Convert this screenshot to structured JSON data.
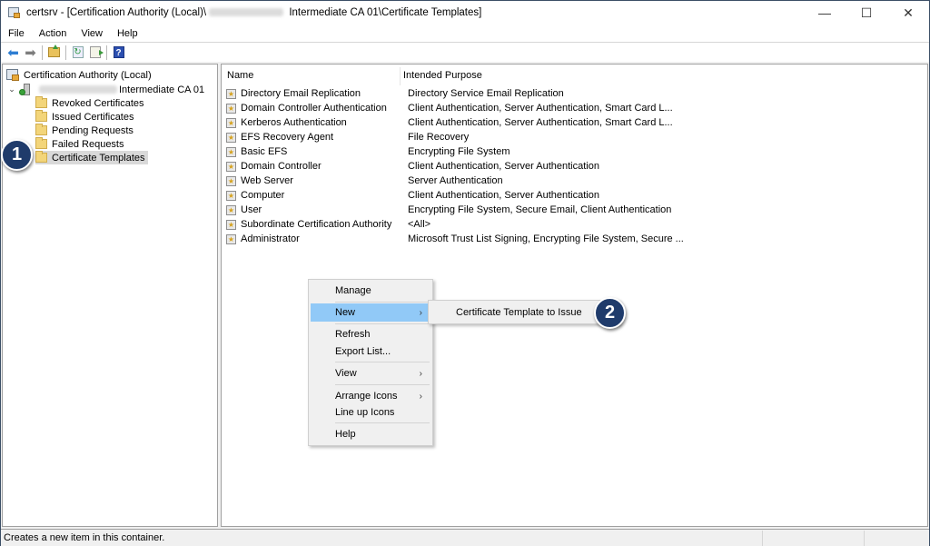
{
  "window": {
    "title_prefix": "certsrv - [Certification Authority (Local)\\",
    "title_suffix": " Intermediate CA 01\\Certificate Templates]",
    "controls": {
      "minimize": "—",
      "maximize": "☐",
      "close": "✕"
    }
  },
  "menubar": {
    "items": [
      "File",
      "Action",
      "View",
      "Help"
    ]
  },
  "toolbar": {
    "icons": [
      "back-arrow-icon",
      "forward-arrow-icon",
      "up-folder-icon",
      "refresh-icon",
      "export-list-icon",
      "help-icon"
    ],
    "help_glyph": "?",
    "back_glyph": "⬅",
    "forward_glyph": "➡",
    "refresh_glyph": "↻"
  },
  "tree": {
    "root": "Certification Authority (Local)",
    "ca_node_suffix": "Intermediate CA 01",
    "expand_glyph": "⌄",
    "children": [
      {
        "label": "Revoked Certificates",
        "selected": false
      },
      {
        "label": "Issued Certificates",
        "selected": false
      },
      {
        "label": "Pending Requests",
        "selected": false
      },
      {
        "label": "Failed Requests",
        "selected": false
      },
      {
        "label": "Certificate Templates",
        "selected": true
      }
    ]
  },
  "list": {
    "columns": [
      "Name",
      "Intended Purpose"
    ],
    "rows": [
      {
        "name": "Directory Email Replication",
        "purpose": "Directory Service Email Replication"
      },
      {
        "name": "Domain Controller Authentication",
        "purpose": "Client Authentication, Server Authentication, Smart Card L..."
      },
      {
        "name": "Kerberos Authentication",
        "purpose": "Client Authentication, Server Authentication, Smart Card L..."
      },
      {
        "name": "EFS Recovery Agent",
        "purpose": "File Recovery"
      },
      {
        "name": "Basic EFS",
        "purpose": "Encrypting File System"
      },
      {
        "name": "Domain Controller",
        "purpose": "Client Authentication, Server Authentication"
      },
      {
        "name": "Web Server",
        "purpose": "Server Authentication"
      },
      {
        "name": "Computer",
        "purpose": "Client Authentication, Server Authentication"
      },
      {
        "name": "User",
        "purpose": "Encrypting File System, Secure Email, Client Authentication"
      },
      {
        "name": "Subordinate Certification Authority",
        "purpose": "<All>"
      },
      {
        "name": "Administrator",
        "purpose": "Microsoft Trust List Signing, Encrypting File System, Secure ..."
      }
    ]
  },
  "context_menu": {
    "items": [
      {
        "label": "Manage",
        "submenu": false,
        "highlighted": false
      },
      {
        "label": "New",
        "submenu": true,
        "highlighted": true
      },
      {
        "label": "Refresh",
        "submenu": false,
        "highlighted": false
      },
      {
        "label": "Export List...",
        "submenu": false,
        "highlighted": false
      },
      {
        "label": "View",
        "submenu": true,
        "highlighted": false
      },
      {
        "label": "Arrange Icons",
        "submenu": true,
        "highlighted": false
      },
      {
        "label": "Line up Icons",
        "submenu": false,
        "highlighted": false
      },
      {
        "label": "Help",
        "submenu": false,
        "highlighted": false
      }
    ],
    "submenu_arrow": "›"
  },
  "submenu": {
    "items": [
      "Certificate Template to Issue"
    ]
  },
  "callouts": [
    "1",
    "2"
  ],
  "statusbar": {
    "text": "Creates a new item in this container."
  }
}
